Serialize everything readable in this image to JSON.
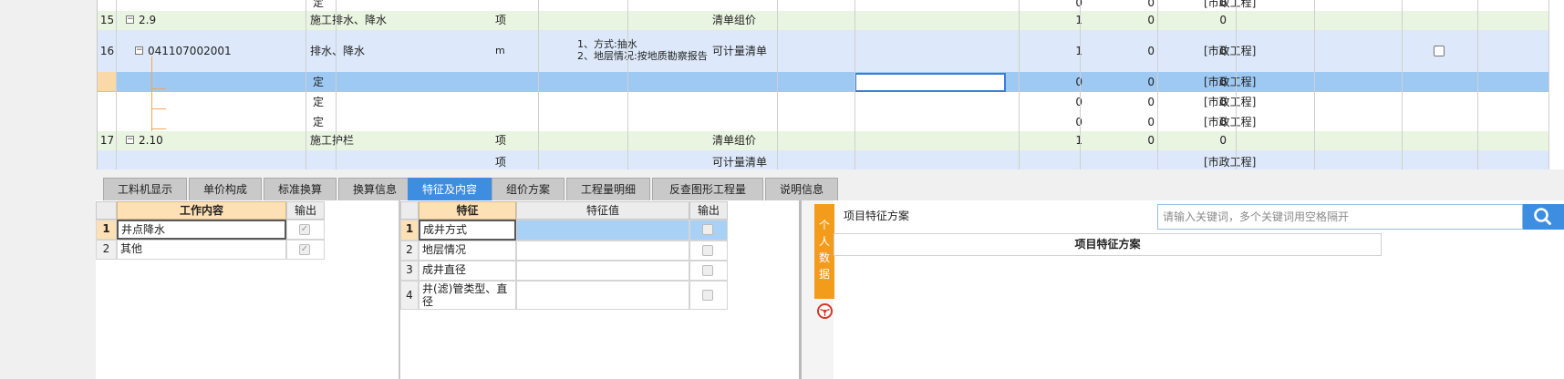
{
  "top_grid": {
    "rows": [
      {
        "no": "15",
        "code": "2.9",
        "type": "",
        "name": "施工排水、降水",
        "unit": "项",
        "feature": "",
        "category": "清单组价",
        "qty": "1",
        "v1": "0",
        "v2": "0",
        "prof": ""
      },
      {
        "no": "16",
        "code": "041107002001",
        "type": "",
        "name": "排水、降水",
        "unit": "m",
        "feature_l1": "1、方式:抽水",
        "feature_l2": "2、地层情况:按地质勘察报告",
        "category": "可计量清单",
        "qty": "1",
        "v1": "0",
        "v2": "0",
        "prof": "[市政工程]"
      },
      {
        "no": "",
        "code": "",
        "type": "定",
        "name": "",
        "unit": "",
        "category": "",
        "qty": "0",
        "v1": "0",
        "v2": "0",
        "prof": "[市政工程]"
      },
      {
        "no": "",
        "code": "",
        "type": "定",
        "name": "",
        "unit": "",
        "category": "",
        "qty": "0",
        "v1": "0",
        "v2": "0",
        "prof": "[市政工程]"
      },
      {
        "no": "",
        "code": "",
        "type": "定",
        "name": "",
        "unit": "",
        "category": "",
        "qty": "0",
        "v1": "0",
        "v2": "0",
        "prof": "[市政工程]"
      },
      {
        "no": "17",
        "code": "2.10",
        "type": "",
        "name": "施工护栏",
        "unit": "项",
        "category": "清单组价",
        "qty": "1",
        "v1": "0",
        "v2": "0",
        "prof": ""
      }
    ],
    "partial_top_row_type": "定",
    "partial_bottom_row": {
      "unit": "项",
      "category": "可计量清单",
      "prof": "[市政工程]"
    }
  },
  "tabs": [
    {
      "label": "工料机显示",
      "active": false
    },
    {
      "label": "单价构成",
      "active": false
    },
    {
      "label": "标准换算",
      "active": false
    },
    {
      "label": "换算信息",
      "active": false
    },
    {
      "label": "特征及内容",
      "active": true
    },
    {
      "label": "组价方案",
      "active": false
    },
    {
      "label": "工程量明细",
      "active": false
    },
    {
      "label": "反查图形工程量",
      "active": false
    },
    {
      "label": "说明信息",
      "active": false
    }
  ],
  "work_panel": {
    "header_content": "工作内容",
    "header_output": "输出",
    "rows": [
      {
        "no": "1",
        "content": "井点降水",
        "output": true
      },
      {
        "no": "2",
        "content": "其他",
        "output": true
      }
    ]
  },
  "feature_panel": {
    "header_feature": "特征",
    "header_value": "特征值",
    "header_output": "输出",
    "rows": [
      {
        "no": "1",
        "feature": "成井方式",
        "value": ""
      },
      {
        "no": "2",
        "feature": "地层情况",
        "value": ""
      },
      {
        "no": "3",
        "feature": "成井直径",
        "value": ""
      },
      {
        "no": "4",
        "feature_l1": "井(滤)管类型、直",
        "feature_l2": "径",
        "value": ""
      }
    ]
  },
  "scheme": {
    "side_tab": [
      "个",
      "人",
      "数",
      "据"
    ],
    "title": "项目特征方案",
    "search_placeholder": "请输入关键词，多个关键词用空格隔开",
    "table_header": "项目特征方案"
  },
  "colors": {
    "accent": "#3d8de0",
    "orange": "#f39b1b",
    "group_row": "#eaf5e1",
    "item_row": "#dde9fa",
    "selected_row": "#9ec9f3"
  }
}
